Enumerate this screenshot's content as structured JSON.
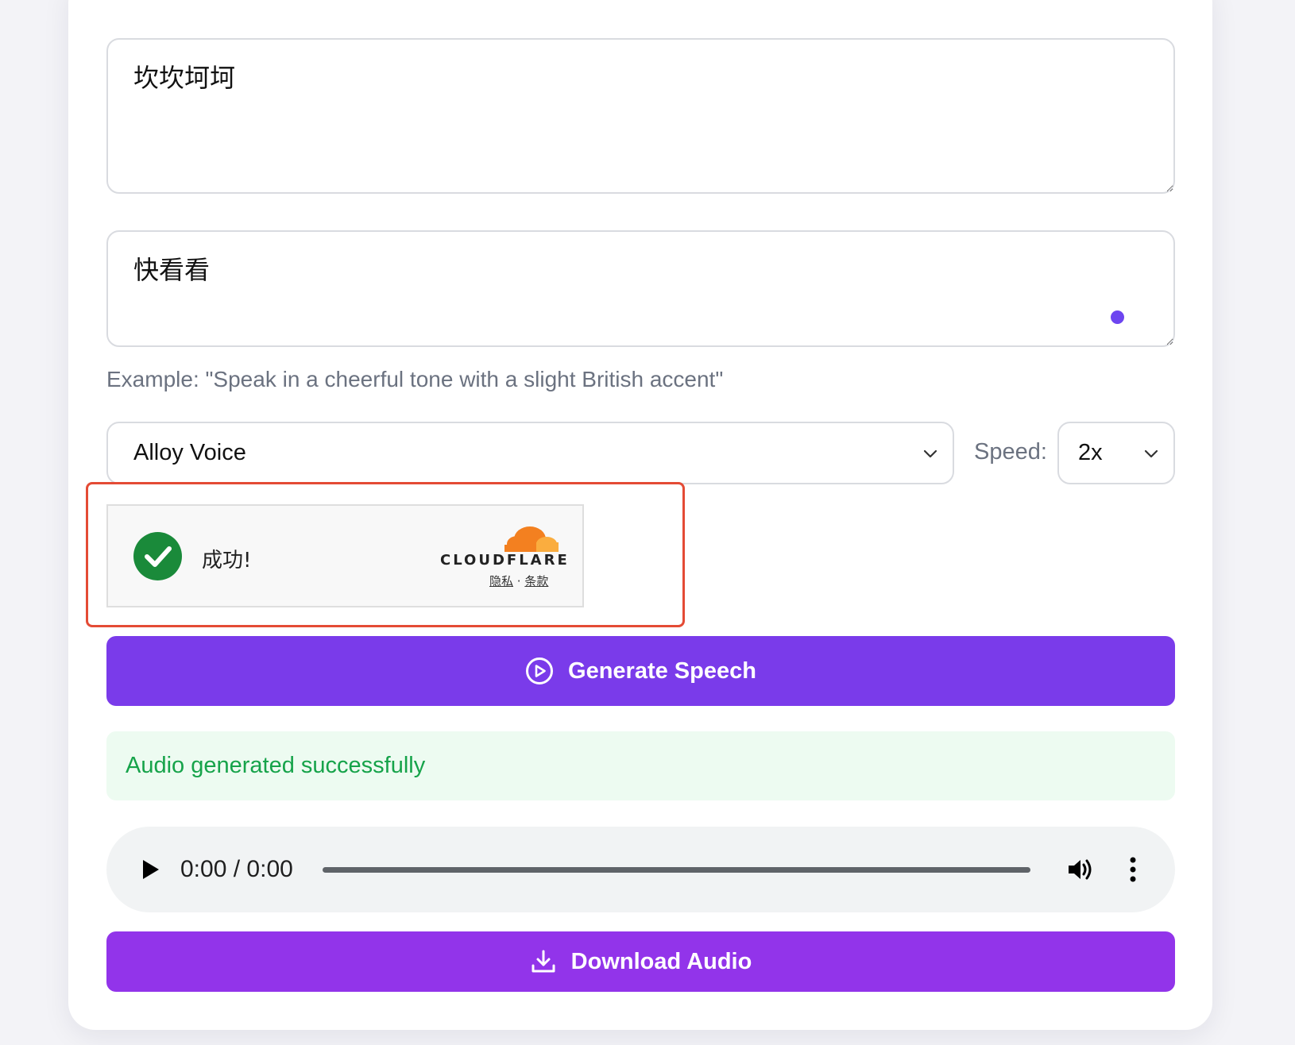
{
  "text_input": {
    "value": "坎坎坷坷"
  },
  "instructions_input": {
    "value": "快看看"
  },
  "instructions_hint": "Example: \"Speak in a cheerful tone with a slight British accent\"",
  "voice_select": {
    "value": "Alloy Voice"
  },
  "speed": {
    "label": "Speed:",
    "value": "2x"
  },
  "turnstile": {
    "status": "成功!",
    "brand": "CLOUDFLARE",
    "privacy": "隐私",
    "separator": "·",
    "terms": "条款"
  },
  "generate_button": {
    "label": "Generate Speech",
    "icon": "play-circle-icon"
  },
  "status_message": "Audio generated successfully",
  "audio_player": {
    "current": "0:00",
    "separator": "/",
    "duration": "0:00",
    "progress": 0
  },
  "download_button": {
    "label": "Download Audio",
    "icon": "download-icon"
  },
  "colors": {
    "primary": "#7a3bea",
    "download": "#9234ea",
    "success_text": "#16a34a",
    "success_bg": "#edfbf1",
    "highlight": "#e44b35",
    "cloudflare_orange": "#f38020"
  }
}
